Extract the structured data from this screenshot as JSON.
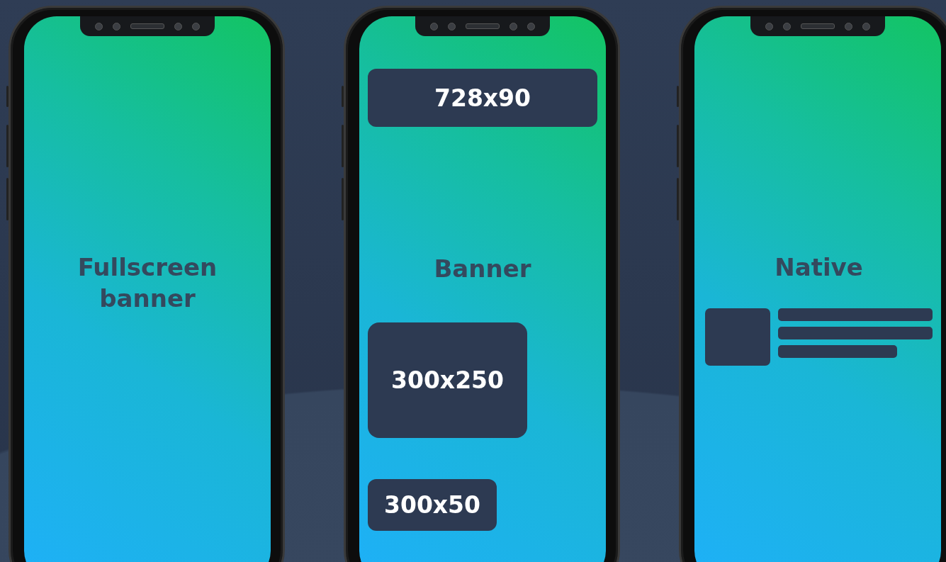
{
  "phones": [
    {
      "kind": "fullscreen",
      "items": [
        {
          "kind": "title",
          "text": "Fullscreen banner"
        }
      ]
    },
    {
      "kind": "banner",
      "items": [
        {
          "kind": "ad_wide",
          "text": "728x90"
        },
        {
          "kind": "title",
          "text": "Banner"
        },
        {
          "kind": "ad_box",
          "text": "300x250"
        },
        {
          "kind": "ad_small",
          "text": "300x50"
        }
      ]
    },
    {
      "kind": "native",
      "items": [
        {
          "kind": "title",
          "text": "Native"
        },
        {
          "kind": "native_ad"
        }
      ]
    }
  ]
}
